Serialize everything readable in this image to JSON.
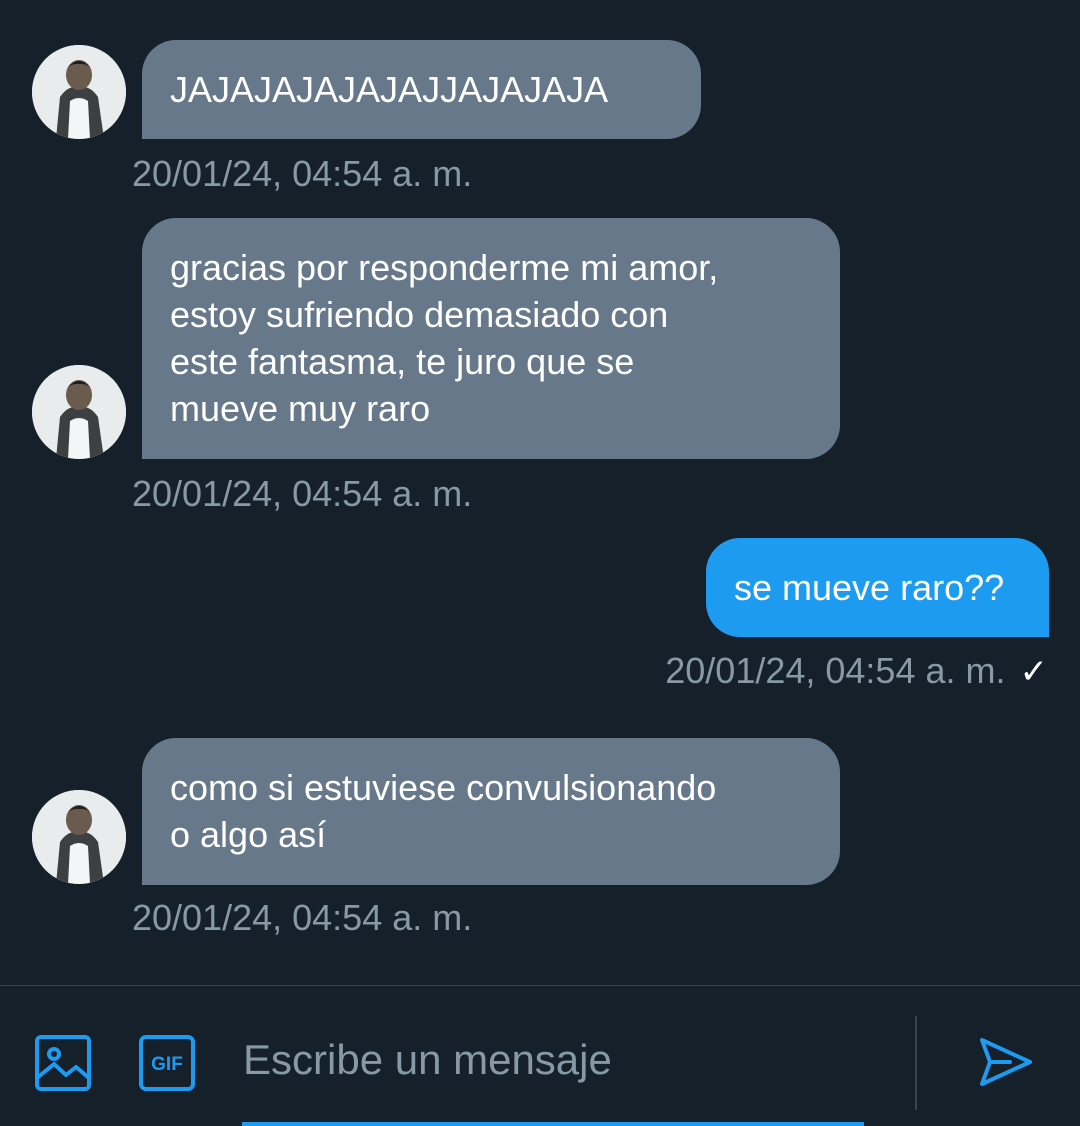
{
  "conversation": {
    "messages": [
      {
        "direction": "incoming",
        "lines": [
          "JAJAJAJAJAJAJJAJAJAJA"
        ],
        "timestamp": "20/01/24, 04:54 a. m."
      },
      {
        "direction": "incoming",
        "lines": [
          "gracias por responderme mi amor,",
          "estoy sufriendo demasiado con",
          "este fantasma, te juro que se",
          "mueve muy raro"
        ],
        "timestamp": "20/01/24, 04:54 a. m."
      },
      {
        "direction": "outgoing",
        "lines": [
          "se mueve raro??"
        ],
        "timestamp": "20/01/24, 04:54 a. m.",
        "status_icon": "check-icon",
        "status_glyph": "✓"
      },
      {
        "direction": "incoming",
        "lines": [
          "como si estuviese convulsionando",
          "o algo así"
        ],
        "timestamp": "20/01/24, 04:54 a. m."
      }
    ]
  },
  "composer": {
    "placeholder": "Escribe un mensaje",
    "gif_label": "GIF",
    "icons": [
      "image-icon",
      "gif-icon",
      "send-icon"
    ]
  },
  "colors": {
    "background": "#15202b",
    "incoming_bubble": "#66788a",
    "outgoing_bubble": "#1d9bf0",
    "timestamp": "#8899a6",
    "accent": "#1d9bf0"
  }
}
